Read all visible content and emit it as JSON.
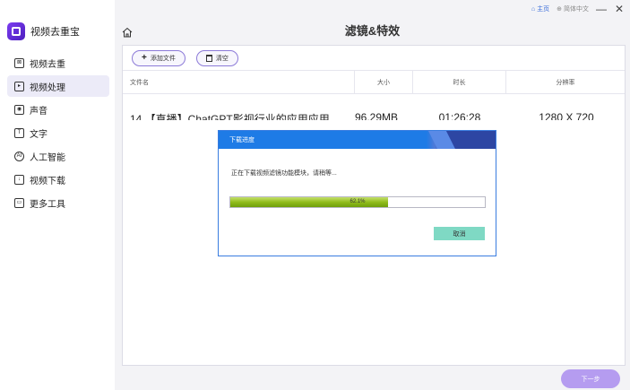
{
  "app": {
    "name": "视频去重宝"
  },
  "sidebar": {
    "items": [
      {
        "label": "视频去重",
        "icon": "dedupe-icon",
        "active": false
      },
      {
        "label": "视频处理",
        "icon": "video-process-icon",
        "active": true
      },
      {
        "label": "声音",
        "icon": "audio-icon",
        "active": false
      },
      {
        "label": "文字",
        "icon": "text-icon",
        "active": false
      },
      {
        "label": "人工智能",
        "icon": "ai-icon",
        "active": false
      },
      {
        "label": "视频下载",
        "icon": "download-icon",
        "active": false
      },
      {
        "label": "更多工具",
        "icon": "toolbox-icon",
        "active": false
      }
    ]
  },
  "topbar": {
    "home_label": "主页",
    "lang_label": "简体中文",
    "minimize": "—",
    "close": "✕"
  },
  "page": {
    "title": "滤镜&特效"
  },
  "toolbar": {
    "add_label": "添加文件",
    "add_symbol": "+",
    "clear_label": "清空"
  },
  "table": {
    "columns": [
      "文件名",
      "大小",
      "时长",
      "分辨率"
    ],
    "rows": [
      {
        "name": "14 【直播】ChatGPT影视行业的应用应用",
        "size": "96.29MB",
        "duration": "01:26:28",
        "resolution": "1280 X 720"
      }
    ]
  },
  "footer": {
    "next_label": "下一步"
  },
  "modal": {
    "title": "下载进度",
    "message": "正在下载视频滤镜功能模块，请稍等...",
    "progress_percent": 62.1,
    "progress_text": "62.1%",
    "cancel_label": "取消"
  },
  "colors": {
    "accent": "#1e7be6",
    "progress": "#90bc1c",
    "cancel": "#7fd9c4",
    "next": "#b59cf0"
  }
}
